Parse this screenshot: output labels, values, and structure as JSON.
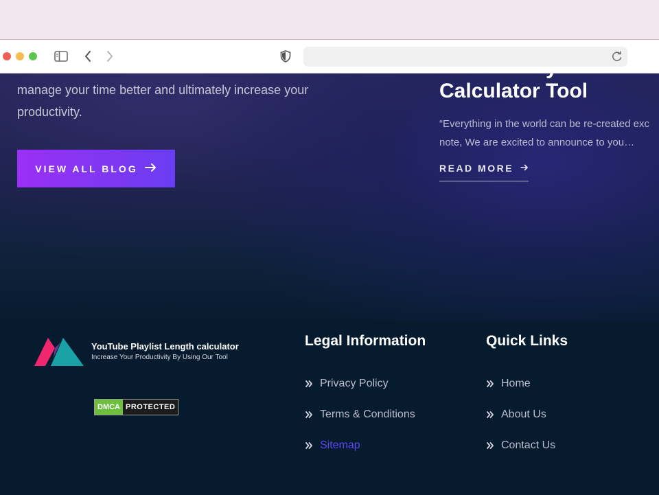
{
  "browser": {
    "icons": [
      "sidebar-icon",
      "back-icon",
      "forward-icon",
      "shield-icon",
      "reload-icon"
    ],
    "address_value": ""
  },
  "hero": {
    "intro_text": "manage your time better and ultimately increase your productivity.",
    "view_all_label": "VIEW ALL BLOG",
    "post_title_prev": "y",
    "post_title": "Calculator Tool",
    "post_excerpt_line1": "“Everything in the world can be re-created exc",
    "post_excerpt_line2": "note, We are excited to announce to you…",
    "read_more_label": "READ MORE"
  },
  "footer": {
    "brand_name": "YouTube Playlist Length calculator",
    "brand_tagline": "Increase Your Productivity By Using Our Tool",
    "dmca_left": "DMCA",
    "dmca_right": "PROTECTED",
    "legal_title": "Legal Information",
    "legal_links": [
      {
        "label": "Privacy Policy"
      },
      {
        "label": "Terms & Conditions"
      },
      {
        "label": "Sitemap"
      }
    ],
    "quick_title": "Quick Links",
    "quick_links": [
      {
        "label": "Home"
      },
      {
        "label": "About Us"
      },
      {
        "label": "Contact Us"
      }
    ]
  },
  "colors": {
    "accent_purple": "#9b2ff5",
    "active_link": "#5b46f2",
    "footer_bg": "#071b2e",
    "logo_pink": "#f0266e",
    "logo_teal": "#1aa3a6"
  }
}
